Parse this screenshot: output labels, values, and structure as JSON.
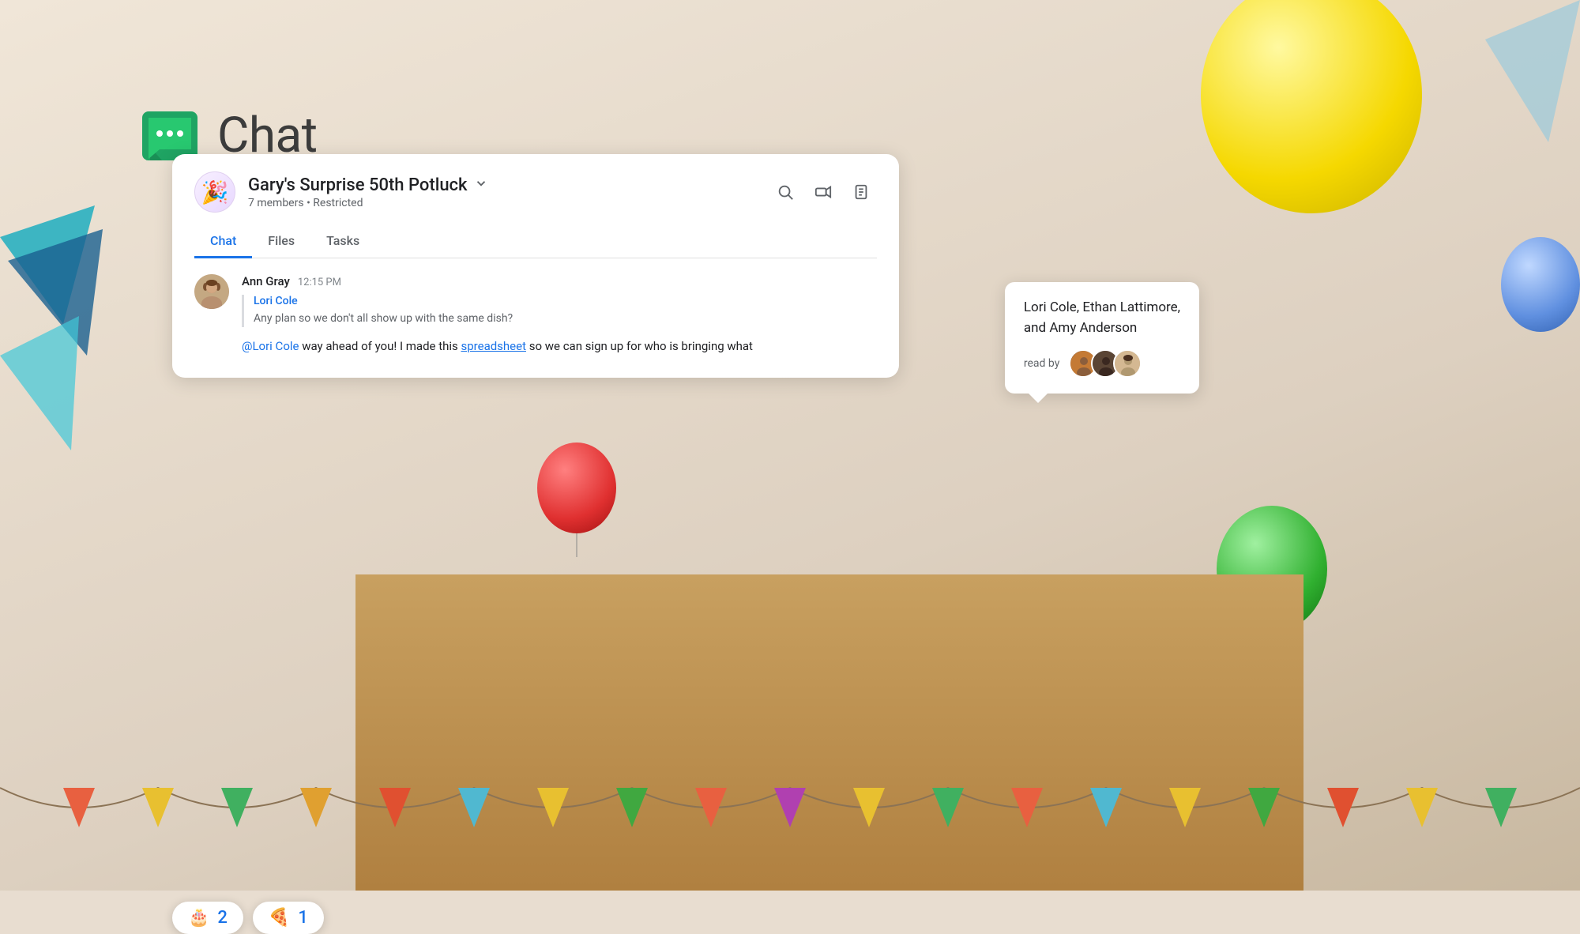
{
  "app": {
    "title": "Chat",
    "logo_color": "#1fa463"
  },
  "background": {
    "color": "#e8ddd0"
  },
  "group": {
    "name": "Gary's Surprise 50th Potluck",
    "members_count": "7 members",
    "restriction": "Restricted",
    "avatar_emoji": "🎉"
  },
  "tabs": [
    {
      "label": "Chat",
      "active": true
    },
    {
      "label": "Files",
      "active": false
    },
    {
      "label": "Tasks",
      "active": false
    }
  ],
  "message": {
    "sender": "Ann Gray",
    "time": "12:15 PM",
    "quoted_sender": "Lori Cole",
    "quoted_text": "Any plan so we don't all show up with the same dish?",
    "text_before_mention": "",
    "mention": "@Lori Cole",
    "text_after_mention": " way ahead of you! I made this ",
    "link": "spreadsheet",
    "text_end": " so we can sign up for who is bringing what"
  },
  "reactions": [
    {
      "emoji": "🎂",
      "count": "2"
    },
    {
      "emoji": "🍕",
      "count": "1"
    }
  ],
  "read_by": {
    "label": "read by",
    "names": "Lori Cole, Ethan Lattimore,\nand Amy Anderson",
    "avatars": [
      {
        "color": "#8B5E3C",
        "label": "avatar-person-1"
      },
      {
        "color": "#4A3728",
        "label": "avatar-person-2"
      },
      {
        "color": "#C4A882",
        "label": "avatar-person-3"
      }
    ]
  },
  "header_actions": [
    {
      "icon": "search",
      "label": "Search"
    },
    {
      "icon": "video",
      "label": "Video call"
    },
    {
      "icon": "notes",
      "label": "Notes"
    }
  ]
}
